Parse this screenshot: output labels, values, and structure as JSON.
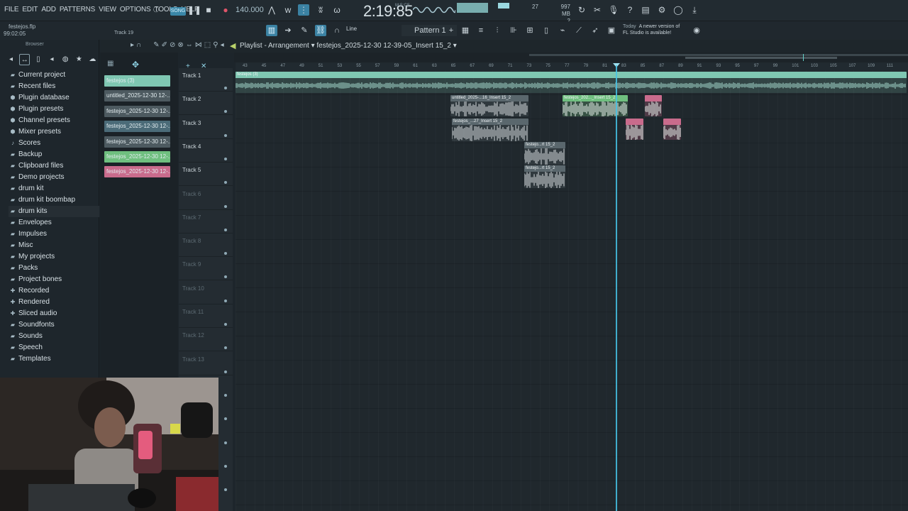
{
  "menu": [
    "FILE",
    "EDIT",
    "ADD",
    "PATTERNS",
    "VIEW",
    "OPTIONS",
    "TOOLS",
    "HELP"
  ],
  "transport": {
    "mode_label": "SONG",
    "tempo": "140.000",
    "time": "2:19:85",
    "time_unit": "M:S:CS"
  },
  "monitor": {
    "cpu": "27",
    "memory": "997 MB",
    "polyphony": "2"
  },
  "project": {
    "file": "festejos.flp",
    "time": "99:02:05",
    "hint": "Track 19"
  },
  "toolbar2": {
    "snap": "Line",
    "pattern": "Pattern 1"
  },
  "notice": {
    "line1": "Today",
    "line2": "A newer version of",
    "line3": "FL Studio is available!"
  },
  "browser": {
    "title": "Browser",
    "items": [
      {
        "icon": "folder-icon",
        "label": "Current project"
      },
      {
        "icon": "clock-icon",
        "label": "Recent files"
      },
      {
        "icon": "plug-icon",
        "label": "Plugin database"
      },
      {
        "icon": "plug-icon",
        "label": "Plugin presets"
      },
      {
        "icon": "plug-icon",
        "label": "Channel presets"
      },
      {
        "icon": "mixer-icon",
        "label": "Mixer presets"
      },
      {
        "icon": "note-icon",
        "label": "Scores"
      },
      {
        "icon": "folder-icon",
        "label": "Backup"
      },
      {
        "icon": "folder-icon",
        "label": "Clipboard files"
      },
      {
        "icon": "folder-icon",
        "label": "Demo projects"
      },
      {
        "icon": "folder-icon",
        "label": "drum kit"
      },
      {
        "icon": "folder-icon",
        "label": "drum kit boombap"
      },
      {
        "icon": "folder-icon",
        "label": "drum kits"
      },
      {
        "icon": "folder-icon",
        "label": "Envelopes"
      },
      {
        "icon": "folder-icon",
        "label": "Impulses"
      },
      {
        "icon": "folder-icon",
        "label": "Misc"
      },
      {
        "icon": "folder-icon",
        "label": "My projects"
      },
      {
        "icon": "folder-icon",
        "label": "Packs"
      },
      {
        "icon": "folder-icon",
        "label": "Project bones"
      },
      {
        "icon": "plus-icon",
        "label": "Recorded"
      },
      {
        "icon": "plus-icon",
        "label": "Rendered"
      },
      {
        "icon": "plus-icon",
        "label": "Sliced audio"
      },
      {
        "icon": "folder-icon",
        "label": "Soundfonts"
      },
      {
        "icon": "folder-icon",
        "label": "Sounds"
      },
      {
        "icon": "folder-icon",
        "label": "Speech"
      },
      {
        "icon": "folder-icon",
        "label": "Templates"
      }
    ]
  },
  "clip_sources": [
    {
      "label": "festejos (3)",
      "color": "#7fc7b2"
    },
    {
      "label": "untitled_2025-12-30 12-...",
      "color": "#4d5a60"
    },
    {
      "label": "festejos_2025-12-30 12-...",
      "color": "#4d5a60"
    },
    {
      "label": "festejos_2025-12-30 12-...",
      "color": "#4b6b78"
    },
    {
      "label": "festejos_2025-12-30 12-...",
      "color": "#4d5a60"
    },
    {
      "label": "festejos_2025-12-30 12-...",
      "color": "#6fbf7f"
    },
    {
      "label": "festejos_2025-12-30 12-...",
      "color": "#c96b8c"
    }
  ],
  "playlist": {
    "title": "Playlist - Arrangement",
    "current_clip": "festejos_2025-12-30 12-39-05_Insert 15_2",
    "ruler": [
      "43",
      "45",
      "47",
      "49",
      "51",
      "53",
      "55",
      "57",
      "59",
      "61",
      "63",
      "65",
      "67",
      "69",
      "71",
      "73",
      "75",
      "77",
      "79",
      "81",
      "83",
      "85",
      "87",
      "89",
      "91",
      "93",
      "95",
      "97",
      "99",
      "101",
      "103",
      "105",
      "107",
      "109",
      "111"
    ],
    "tracks": [
      "Track 1",
      "Track 2",
      "Track 3",
      "Track 4",
      "Track 5",
      "Track 6",
      "Track 7",
      "Track 8",
      "Track 9",
      "Track 10",
      "Track 11",
      "Track 12",
      "Track 13"
    ],
    "clips": [
      {
        "label": "festejos (3)",
        "color": "#7fc7b2"
      },
      {
        "label": "untitled_2025-...16_Insert 15_2",
        "color": "#5a676d"
      },
      {
        "label": "festejos_202..._Insert 15_2",
        "color": "#6fbf7f"
      },
      {
        "label": "",
        "color": "#c96b8c"
      },
      {
        "label": "festejos_...27_Insert 15_2",
        "color": "#5a676d"
      },
      {
        "label": "",
        "color": "#c96b8c"
      },
      {
        "label": "",
        "color": "#c96b8c"
      },
      {
        "label": "festejo...rt 15_2",
        "color": "#5a676d"
      },
      {
        "label": "festejo...rt 15_2",
        "color": "#5a676d"
      }
    ]
  }
}
